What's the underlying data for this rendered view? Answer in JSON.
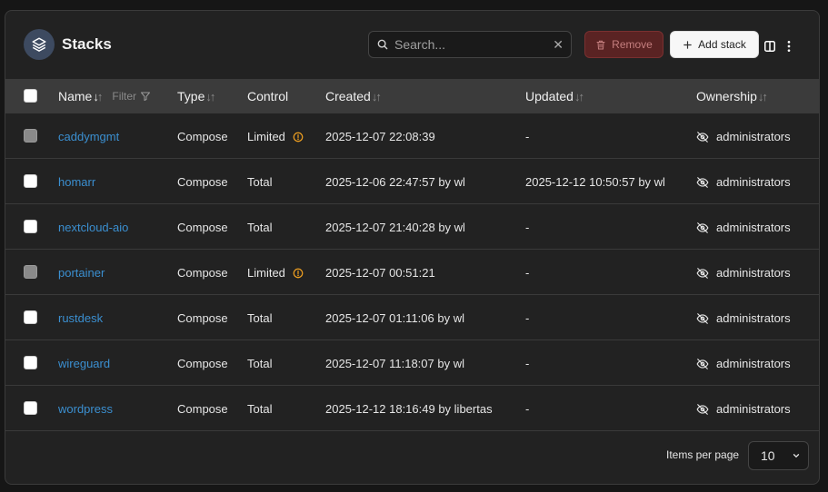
{
  "header": {
    "title": "Stacks",
    "search_placeholder": "Search...",
    "remove_label": "Remove",
    "add_label": "Add stack"
  },
  "table": {
    "columns": {
      "name": "Name",
      "filter": "Filter",
      "type": "Type",
      "control": "Control",
      "created": "Created",
      "updated": "Updated",
      "ownership": "Ownership"
    },
    "rows": [
      {
        "name": "caddymgmt",
        "type": "Compose",
        "control": "Limited",
        "limited": true,
        "created": "2025-12-07 22:08:39",
        "updated": "-",
        "ownership": "administrators"
      },
      {
        "name": "homarr",
        "type": "Compose",
        "control": "Total",
        "limited": false,
        "created": "2025-12-06 22:47:57 by wl",
        "updated": "2025-12-12 10:50:57 by wl",
        "ownership": "administrators"
      },
      {
        "name": "nextcloud-aio",
        "type": "Compose",
        "control": "Total",
        "limited": false,
        "created": "2025-12-07 21:40:28 by wl",
        "updated": "-",
        "ownership": "administrators"
      },
      {
        "name": "portainer",
        "type": "Compose",
        "control": "Limited",
        "limited": true,
        "created": "2025-12-07 00:51:21",
        "updated": "-",
        "ownership": "administrators"
      },
      {
        "name": "rustdesk",
        "type": "Compose",
        "control": "Total",
        "limited": false,
        "created": "2025-12-07 01:11:06 by wl",
        "updated": "-",
        "ownership": "administrators"
      },
      {
        "name": "wireguard",
        "type": "Compose",
        "control": "Total",
        "limited": false,
        "created": "2025-12-07 11:18:07 by wl",
        "updated": "-",
        "ownership": "administrators"
      },
      {
        "name": "wordpress",
        "type": "Compose",
        "control": "Total",
        "limited": false,
        "created": "2025-12-12 18:16:49 by libertas",
        "updated": "-",
        "ownership": "administrators"
      }
    ]
  },
  "footer": {
    "items_per_page_label": "Items per page",
    "items_per_page_value": "10"
  },
  "colors": {
    "link": "#3b8fd0",
    "warning": "#f0a020",
    "remove_bg": "#5a2323"
  }
}
